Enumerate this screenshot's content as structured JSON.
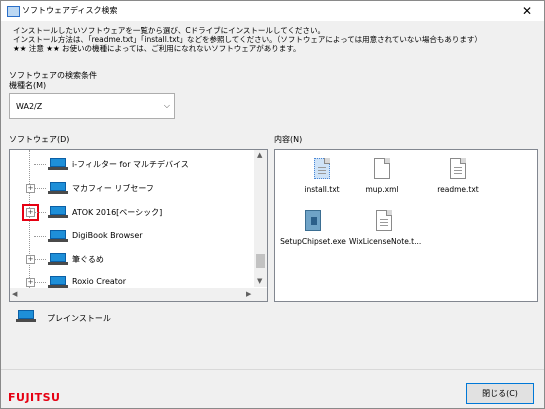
{
  "window": {
    "title": "ソフトウェアディスク検索",
    "close_glyph": "✕"
  },
  "instructions": [
    "インストールしたいソフトウェアを一覧から選び、Cドライブにインストールしてください。",
    "インストール方法は、「readme.txt」「install.txt」などを参照してください。（ソフトウェアによっては用意されていない場合もあります）",
    "★★ 注意 ★★ お使いの機種によっては、ご利用になれないソフトウェアがあります。"
  ],
  "search": {
    "section_label": "ソフトウェアの検索条件",
    "model_label": "機種名(M)",
    "model_value": "WA2/Z",
    "dropdown_icon": "chevron-down-icon"
  },
  "software": {
    "label": "ソフトウェア(D)",
    "items": [
      {
        "label": "i-フィルター for マルチデバイス",
        "expandable": false
      },
      {
        "label": "マカフィー リブセーフ",
        "expandable": true
      },
      {
        "label": "ATOK 2016[ベーシック]",
        "expandable": true,
        "highlighted": true
      },
      {
        "label": "DigiBook Browser",
        "expandable": false
      },
      {
        "label": "筆ぐるめ",
        "expandable": true
      },
      {
        "label": "Roxio Creator",
        "expandable": true
      }
    ],
    "expander_glyph": "+",
    "item_icon": "laptop-icon"
  },
  "contents": {
    "label": "内容(N)",
    "files": [
      {
        "name": "install.txt",
        "icon": "text-file-icon",
        "selected": true
      },
      {
        "name": "mup.xml",
        "icon": "document-icon"
      },
      {
        "name": "readme.txt",
        "icon": "text-file-icon"
      },
      {
        "name": "SetupChipset.exe",
        "icon": "installer-icon"
      },
      {
        "name": "WixLicenseNote.t...",
        "icon": "text-file-icon"
      }
    ]
  },
  "preinstall": {
    "label": "プレインストール",
    "icon": "laptop-icon"
  },
  "footer": {
    "logo": "FUJITSU",
    "close_button": "閉じる(C)"
  },
  "colors": {
    "brand_red": "#e60012",
    "highlight_border": "#e60012",
    "focus_blue": "#0078d7"
  }
}
